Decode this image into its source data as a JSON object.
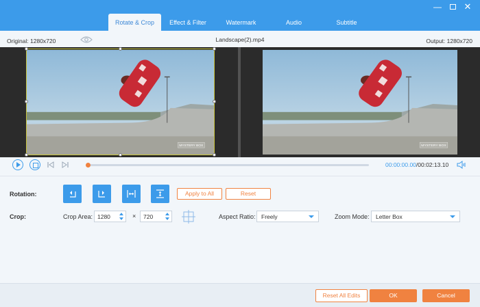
{
  "tabs": [
    {
      "label": "Rotate & Crop",
      "active": true
    },
    {
      "label": "Effect & Filter",
      "active": false
    },
    {
      "label": "Watermark",
      "active": false
    },
    {
      "label": "Audio",
      "active": false
    },
    {
      "label": "Subtitle",
      "active": false
    }
  ],
  "window_controls": {
    "minimize": "—",
    "close": "✕"
  },
  "preview": {
    "original_label": "Original: 1280x720",
    "file_name": "Landscape(2).mp4",
    "output_label": "Output: 1280x720",
    "watermark_text": "MYSTERY BOX"
  },
  "playback": {
    "current_time": "00:00:00.00",
    "total_time": "/00:02:13.10",
    "progress": 0
  },
  "rotation": {
    "label": "Rotation:",
    "apply_all": "Apply to All",
    "reset": "Reset"
  },
  "crop": {
    "label": "Crop:",
    "area_label": "Crop Area:",
    "width": "1280",
    "height": "720",
    "times": "×",
    "aspect_label": "Aspect Ratio:",
    "aspect_value": "Freely",
    "zoom_label": "Zoom Mode:",
    "zoom_value": "Letter Box"
  },
  "footer": {
    "reset_all": "Reset All Edits",
    "ok": "OK",
    "cancel": "Cancel"
  },
  "colors": {
    "accent": "#3c9bea",
    "action": "#f08240",
    "crop_border": "#c7c23a"
  }
}
